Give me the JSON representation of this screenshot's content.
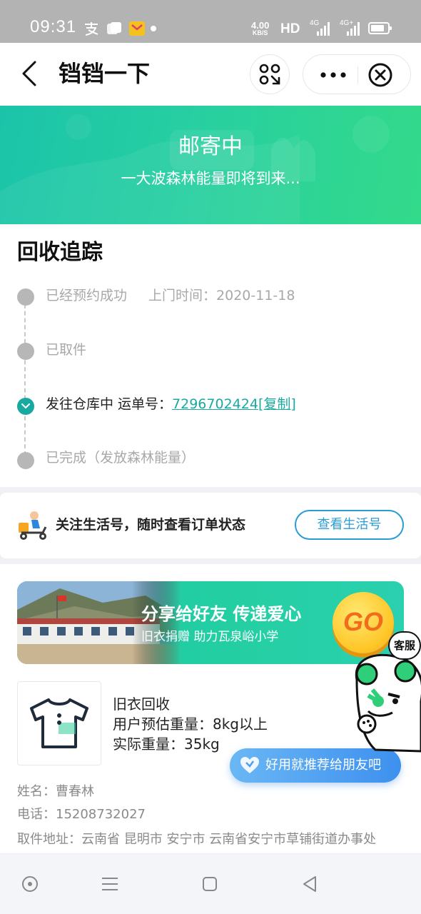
{
  "status_bar": {
    "time": "09:31",
    "net_speed_value": "4.00",
    "net_speed_unit": "KB/S",
    "hd_label": "HD",
    "net_1": "4G",
    "net_2": "4G+",
    "icons": [
      "alipay-icon",
      "app-icon",
      "mail-icon",
      "dot-icon",
      "signal-icon",
      "battery-icon"
    ]
  },
  "app_bar": {
    "title": "铛铛一下",
    "icons": [
      "back-icon",
      "scan-icon",
      "more-icon",
      "close-icon"
    ]
  },
  "banner": {
    "status": "邮寄中",
    "subtitle": "一大波森林能量即将到来..."
  },
  "tracking": {
    "title": "回收追踪",
    "steps": [
      {
        "label": "已经预约成功",
        "detail": "上门时间：2020-11-18",
        "state": "done"
      },
      {
        "label": "已取件",
        "detail": "",
        "state": "done"
      },
      {
        "label": "发往仓库中 运单号：",
        "tracking_number": "7296702424",
        "copy_label": "[复制]",
        "state": "active"
      },
      {
        "label": "已完成（发放森林能量）",
        "detail": "",
        "state": "pending"
      }
    ]
  },
  "follow": {
    "text": "关注生活号，随时查看订单状态",
    "button": "查看生活号"
  },
  "promo": {
    "title": "分享给好友 传递爱心",
    "subtitle": "旧衣捐赠 助力瓦泉峪小学",
    "go_label": "GO"
  },
  "order": {
    "product_name": "旧衣回收",
    "estimated_weight": "用户预估重量：8kg以上",
    "actual_weight": "实际重量：35kg",
    "name": "姓名：曹春林",
    "phone": "电话：15208732027",
    "address": "取件地址：云南省 昆明市 安宁市 云南省安宁市草铺街道办事处"
  },
  "floating": {
    "recommend_label": "好用就推荐给朋友吧",
    "service_label": "客服"
  },
  "colors": {
    "accent": "#1aa9a0",
    "banner_start": "#1bc4a9",
    "banner_end": "#33da8a",
    "link_blue": "#2b9bd6",
    "go_yellow": "#ffc72a"
  }
}
